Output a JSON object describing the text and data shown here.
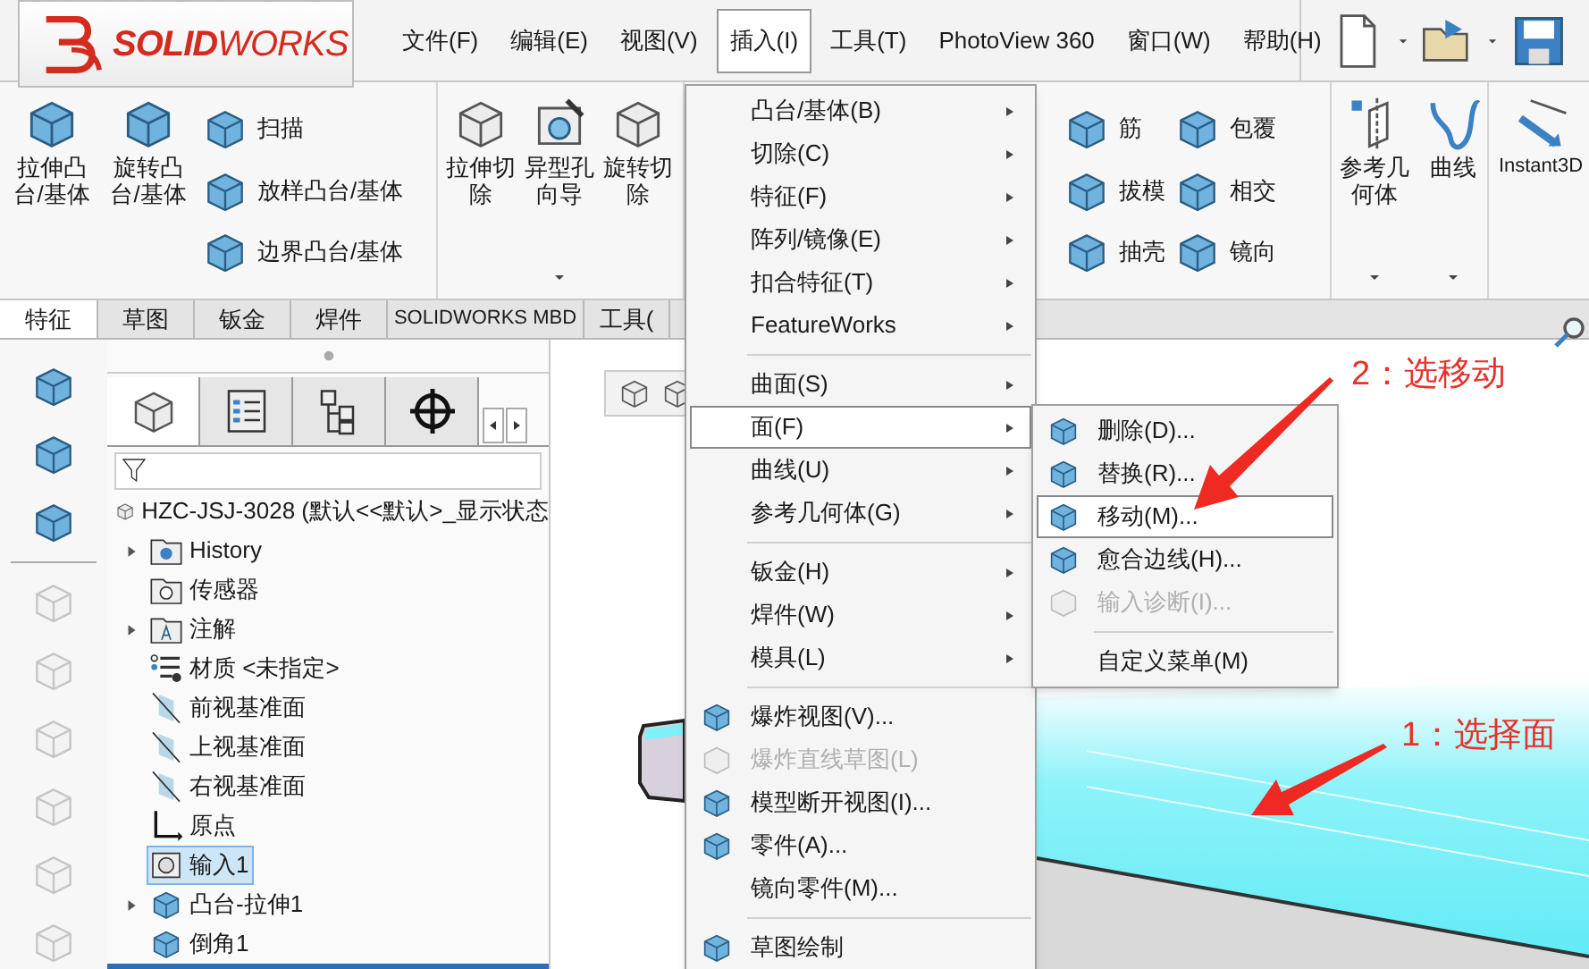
{
  "logo": "**SOLID**WORKS",
  "menu_bar": [
    {
      "label": "文件(F)",
      "selected": false
    },
    {
      "label": "编辑(E)",
      "selected": false
    },
    {
      "label": "视图(V)",
      "selected": false
    },
    {
      "label": "插入(I)",
      "selected": true
    },
    {
      "label": "工具(T)",
      "selected": false
    },
    {
      "label": "PhotoView 360",
      "selected": false
    },
    {
      "label": "窗口(W)",
      "selected": false
    },
    {
      "label": "帮助(H)",
      "selected": false
    }
  ],
  "ribbon": {
    "groups": [
      {
        "items": [
          {
            "kind": "large",
            "label": "拉伸凸台/基体",
            "dropdown": false
          },
          {
            "kind": "large",
            "label": "旋转凸台/基体",
            "dropdown": false
          },
          {
            "kind": "column",
            "items": [
              {
                "label": "扫描"
              },
              {
                "label": "放样凸台/基体"
              },
              {
                "label": "边界凸台/基体"
              }
            ]
          }
        ]
      },
      {
        "items": [
          {
            "kind": "large",
            "label": "拉伸切除",
            "dropdown": false
          },
          {
            "kind": "large",
            "label": "异型孔向导",
            "dropdown": true
          },
          {
            "kind": "large",
            "label": "旋转切除",
            "dropdown": false
          }
        ]
      },
      {
        "items": [
          {
            "kind": "column",
            "items": [
              {
                "label": "筋"
              },
              {
                "label": "拔模"
              },
              {
                "label": "抽壳"
              }
            ]
          },
          {
            "kind": "column",
            "items": [
              {
                "label": "包覆"
              },
              {
                "label": "相交"
              },
              {
                "label": "镜向"
              }
            ]
          }
        ]
      },
      {
        "items": [
          {
            "kind": "large",
            "label": "参考几何体",
            "dropdown": true
          },
          {
            "kind": "large",
            "label": "曲线",
            "dropdown": true
          }
        ]
      },
      {
        "items": [
          {
            "kind": "large",
            "label": "Instant3D",
            "dropdown": false
          }
        ]
      }
    ]
  },
  "tabs": [
    {
      "label": "特征",
      "selected": true
    },
    {
      "label": "草图",
      "selected": false
    },
    {
      "label": "钣金",
      "selected": false
    },
    {
      "label": "焊件",
      "selected": false
    },
    {
      "label": "SOLIDWORKS MBD",
      "selected": false
    },
    {
      "label": "工具(",
      "selected": false
    }
  ],
  "left_toolbar": [
    {
      "disabled": false
    },
    {
      "disabled": false
    },
    {
      "disabled": false
    },
    {
      "disabled": true
    },
    {
      "disabled": true
    },
    {
      "disabled": true
    },
    {
      "disabled": true
    },
    {
      "disabled": true
    },
    {
      "disabled": true
    }
  ],
  "panel_tabs": [
    {
      "selected": true
    },
    {
      "selected": false
    },
    {
      "selected": false
    },
    {
      "selected": false
    }
  ],
  "tree": {
    "root": {
      "label": "HZC-JSJ-3028  (默认<<默认>_显示状态",
      "children": [
        {
          "label": "History",
          "expandable": true,
          "selected": false
        },
        {
          "label": "传感器",
          "expandable": false,
          "selected": false
        },
        {
          "label": "注解",
          "expandable": true,
          "selected": false
        },
        {
          "label": "材质 <未指定>",
          "expandable": false,
          "selected": false
        },
        {
          "label": "前视基准面",
          "expandable": false,
          "selected": false
        },
        {
          "label": "上视基准面",
          "expandable": false,
          "selected": false
        },
        {
          "label": "右视基准面",
          "expandable": false,
          "selected": false
        },
        {
          "label": "原点",
          "expandable": false,
          "selected": false
        },
        {
          "label": "输入1",
          "expandable": false,
          "selected": true
        },
        {
          "label": "凸台-拉伸1",
          "expandable": true,
          "selected": false
        },
        {
          "label": "倒角1",
          "expandable": false,
          "selected": false
        }
      ]
    }
  },
  "insert_menu": [
    {
      "kind": "item",
      "label": "凸台/基体(B)",
      "submenu": true,
      "icon": false,
      "selected": false,
      "disabled": false
    },
    {
      "kind": "item",
      "label": "切除(C)",
      "submenu": true,
      "icon": false,
      "selected": false,
      "disabled": false
    },
    {
      "kind": "item",
      "label": "特征(F)",
      "submenu": true,
      "icon": false,
      "selected": false,
      "disabled": false
    },
    {
      "kind": "item",
      "label": "阵列/镜像(E)",
      "submenu": true,
      "icon": false,
      "selected": false,
      "disabled": false
    },
    {
      "kind": "item",
      "label": "扣合特征(T)",
      "submenu": true,
      "icon": false,
      "selected": false,
      "disabled": false
    },
    {
      "kind": "item",
      "label": "FeatureWorks",
      "submenu": true,
      "icon": false,
      "selected": false,
      "disabled": false
    },
    {
      "kind": "separator"
    },
    {
      "kind": "item",
      "label": "曲面(S)",
      "submenu": true,
      "icon": false,
      "selected": false,
      "disabled": false
    },
    {
      "kind": "item",
      "label": "面(F)",
      "submenu": true,
      "icon": false,
      "selected": true,
      "disabled": false
    },
    {
      "kind": "item",
      "label": "曲线(U)",
      "submenu": true,
      "icon": false,
      "selected": false,
      "disabled": false
    },
    {
      "kind": "item",
      "label": "参考几何体(G)",
      "submenu": true,
      "icon": false,
      "selected": false,
      "disabled": false
    },
    {
      "kind": "separator"
    },
    {
      "kind": "item",
      "label": "钣金(H)",
      "submenu": true,
      "icon": false,
      "selected": false,
      "disabled": false
    },
    {
      "kind": "item",
      "label": "焊件(W)",
      "submenu": true,
      "icon": false,
      "selected": false,
      "disabled": false
    },
    {
      "kind": "item",
      "label": "模具(L)",
      "submenu": true,
      "icon": false,
      "selected": false,
      "disabled": false
    },
    {
      "kind": "separator"
    },
    {
      "kind": "item",
      "label": "爆炸视图(V)...",
      "submenu": false,
      "icon": true,
      "selected": false,
      "disabled": false
    },
    {
      "kind": "item",
      "label": "爆炸直线草图(L)",
      "submenu": false,
      "icon": true,
      "selected": false,
      "disabled": true
    },
    {
      "kind": "item",
      "label": "模型断开视图(I)...",
      "submenu": false,
      "icon": true,
      "selected": false,
      "disabled": false
    },
    {
      "kind": "item",
      "label": "零件(A)...",
      "submenu": false,
      "icon": true,
      "selected": false,
      "disabled": false
    },
    {
      "kind": "item",
      "label": "镜向零件(M)...",
      "submenu": false,
      "icon": false,
      "selected": false,
      "disabled": false
    },
    {
      "kind": "separator"
    },
    {
      "kind": "item",
      "label": "草图绘制",
      "submenu": false,
      "icon": true,
      "selected": false,
      "disabled": false
    }
  ],
  "face_submenu": [
    {
      "kind": "item",
      "label": "删除(D)...",
      "icon": true,
      "selected": false,
      "disabled": false
    },
    {
      "kind": "item",
      "label": "替换(R)...",
      "icon": true,
      "selected": false,
      "disabled": false
    },
    {
      "kind": "item",
      "label": "移动(M)...",
      "icon": true,
      "selected": true,
      "disabled": false
    },
    {
      "kind": "item",
      "label": "愈合边线(H)...",
      "icon": true,
      "selected": false,
      "disabled": false
    },
    {
      "kind": "item",
      "label": "输入诊断(I)...",
      "icon": true,
      "selected": false,
      "disabled": true
    },
    {
      "kind": "separator"
    },
    {
      "kind": "item",
      "label": "自定义菜单(M)",
      "icon": false,
      "selected": false,
      "disabled": false
    }
  ],
  "annotations": [
    {
      "text": "2：选移动"
    },
    {
      "text": "1：选择面"
    }
  ]
}
